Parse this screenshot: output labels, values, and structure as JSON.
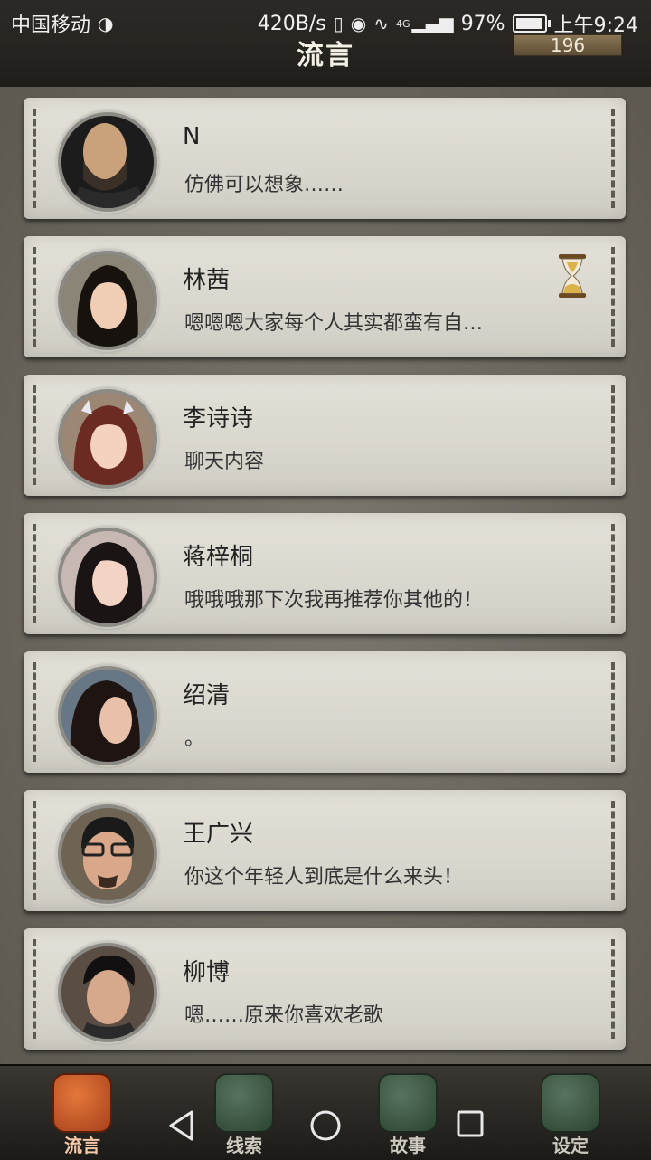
{
  "status_bar": {
    "carrier": "中国移动",
    "speed": "420B/s",
    "network": "4G",
    "battery": "97%",
    "battery_level": 0.97,
    "time": "上午9:24"
  },
  "header": {
    "title": "流言",
    "coins": "196"
  },
  "messages": [
    {
      "name": "N",
      "preview": "仿佛可以想象……",
      "pending": false
    },
    {
      "name": "林茜",
      "preview": "嗯嗯嗯大家每个人其实都蛮有自…",
      "pending": true
    },
    {
      "name": "李诗诗",
      "preview": "聊天内容",
      "pending": false
    },
    {
      "name": "蒋梓桐",
      "preview": "哦哦哦那下次我再推荐你其他的！",
      "pending": false
    },
    {
      "name": "绍清",
      "preview": "。",
      "pending": false
    },
    {
      "name": "王广兴",
      "preview": "你这个年轻人到底是什么来头！",
      "pending": false
    },
    {
      "name": "柳博",
      "preview": "嗯……原来你喜欢老歌",
      "pending": false
    }
  ],
  "tabs": [
    {
      "label": "流言",
      "active": true
    },
    {
      "label": "线索",
      "active": false
    },
    {
      "label": "故事",
      "active": false
    },
    {
      "label": "设定",
      "active": false
    }
  ],
  "colors": {
    "card_bg": "#dedbd3",
    "active_tab": "#d8682e",
    "inactive_tab": "#3d5e46",
    "header_bg": "#25231f"
  }
}
